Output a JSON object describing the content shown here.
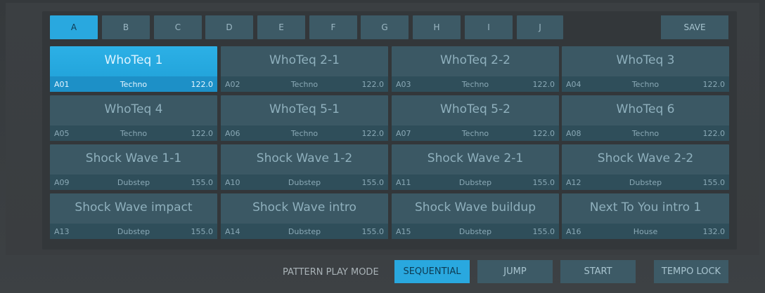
{
  "banks": [
    "A",
    "B",
    "C",
    "D",
    "E",
    "F",
    "G",
    "H",
    "I",
    "J"
  ],
  "active_bank": "A",
  "save_label": "SAVE",
  "pads": [
    {
      "name": "WhoTeq 1",
      "id": "A01",
      "genre": "Techno",
      "bpm": "122.0",
      "active": true
    },
    {
      "name": "WhoTeq 2-1",
      "id": "A02",
      "genre": "Techno",
      "bpm": "122.0"
    },
    {
      "name": "WhoTeq 2-2",
      "id": "A03",
      "genre": "Techno",
      "bpm": "122.0"
    },
    {
      "name": "WhoTeq 3",
      "id": "A04",
      "genre": "Techno",
      "bpm": "122.0"
    },
    {
      "name": "WhoTeq 4",
      "id": "A05",
      "genre": "Techno",
      "bpm": "122.0"
    },
    {
      "name": "WhoTeq 5-1",
      "id": "A06",
      "genre": "Techno",
      "bpm": "122.0"
    },
    {
      "name": "WhoTeq 5-2",
      "id": "A07",
      "genre": "Techno",
      "bpm": "122.0"
    },
    {
      "name": "WhoTeq 6",
      "id": "A08",
      "genre": "Techno",
      "bpm": "122.0"
    },
    {
      "name": "Shock Wave 1-1",
      "id": "A09",
      "genre": "Dubstep",
      "bpm": "155.0"
    },
    {
      "name": "Shock Wave 1-2",
      "id": "A10",
      "genre": "Dubstep",
      "bpm": "155.0"
    },
    {
      "name": "Shock Wave 2-1",
      "id": "A11",
      "genre": "Dubstep",
      "bpm": "155.0"
    },
    {
      "name": "Shock Wave 2-2",
      "id": "A12",
      "genre": "Dubstep",
      "bpm": "155.0"
    },
    {
      "name": "Shock Wave impact",
      "id": "A13",
      "genre": "Dubstep",
      "bpm": "155.0"
    },
    {
      "name": "Shock Wave intro",
      "id": "A14",
      "genre": "Dubstep",
      "bpm": "155.0"
    },
    {
      "name": "Shock Wave buildup",
      "id": "A15",
      "genre": "Dubstep",
      "bpm": "155.0"
    },
    {
      "name": "Next To You intro 1",
      "id": "A16",
      "genre": "House",
      "bpm": "132.0"
    }
  ],
  "bottom": {
    "mode_label": "PATTERN PLAY MODE",
    "sequential": "SEQUENTIAL",
    "jump": "JUMP",
    "start": "START",
    "tempo_lock": "TEMPO LOCK"
  },
  "colors": {
    "accent": "#29a8df",
    "pad": "#3b5864",
    "pad_info": "#2f4e5a"
  }
}
